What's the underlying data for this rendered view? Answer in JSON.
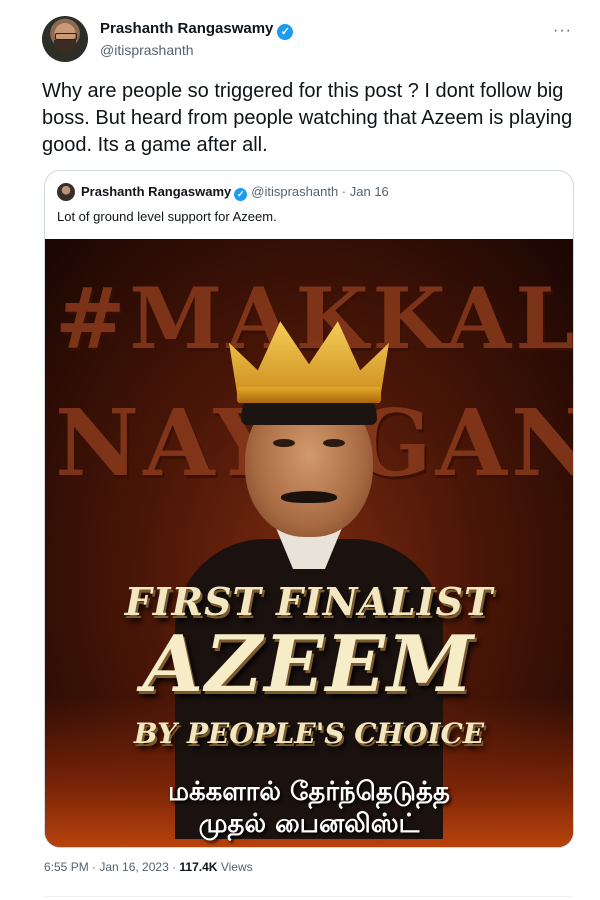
{
  "tweet": {
    "display_name": "Prashanth Rangaswamy",
    "handle": "@itisprashanth",
    "verified_glyph": "✓",
    "more_label": "···",
    "text": "Why are people so triggered for this post ? I dont follow big boss. But heard from people watching that Azeem is playing good. Its a game after all.",
    "timestamp": "6:55 PM · Jan 16, 2023",
    "separator": " · ",
    "views_count": "117.4K",
    "views_label": "Views"
  },
  "quoted": {
    "display_name": "Prashanth Rangaswamy",
    "handle": "@itisprashanth",
    "date": "Jan 16",
    "meta_separator": " · ",
    "text": "Lot of ground level support for Azeem.",
    "image": {
      "bg_line1": "#MAKKAL",
      "bg_line2": "NAYAGAN",
      "title_line1": "FIRST FINALIST",
      "title_line2": "AZEEM",
      "title_line3": "BY PEOPLE'S CHOICE",
      "tamil_line1": "மக்களால் தேர்ந்தெடுத்த",
      "tamil_line2": "முதல் பைனலிஸ்ட்"
    }
  },
  "colors": {
    "verified_blue": "#1d9bf0",
    "secondary_text": "#536471",
    "primary_text": "#0f1419",
    "border": "#cfd9de"
  }
}
